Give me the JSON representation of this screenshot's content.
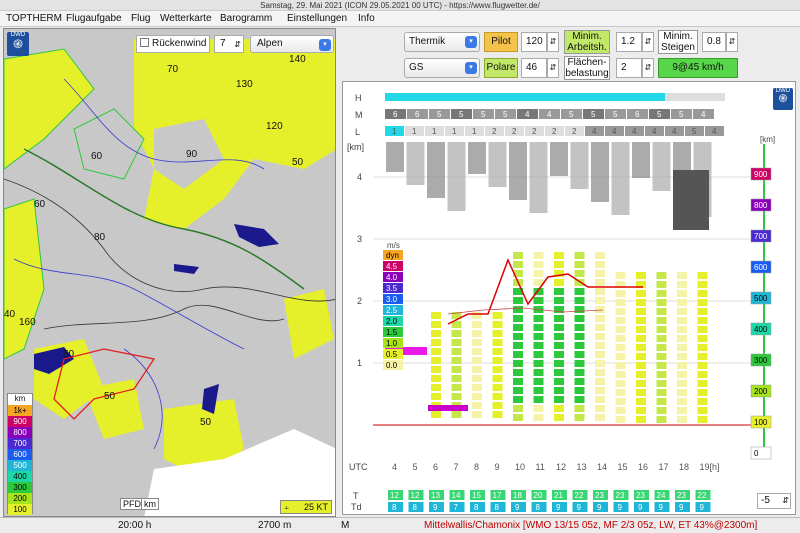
{
  "window": {
    "title": "Samstag, 29. Mai 2021 (ICON 29.05.2021 00 UTC) - https://www.flugwetter.de/"
  },
  "menu": [
    "TOPTHERM",
    "Flugaufgabe",
    "Flug",
    "Wetterkarte",
    "Barogramm",
    "Einstellungen",
    "Info"
  ],
  "map": {
    "dwd_logo": "DWD",
    "tailwind_checkbox_label": "Rückenwind",
    "tailwind_value": "7",
    "region_select": "Alpen",
    "contour_labels": [
      "70",
      "140",
      "130",
      "120",
      "60",
      "90",
      "50",
      "60",
      "80",
      "40",
      "160",
      "50",
      "50",
      "50"
    ],
    "legend": {
      "unit": "km",
      "items": [
        {
          "label": "1k+",
          "color": "#f5a623"
        },
        {
          "label": "900",
          "color": "#cc0066"
        },
        {
          "label": "800",
          "color": "#8a00b8"
        },
        {
          "label": "700",
          "color": "#4b2bd1"
        },
        {
          "label": "600",
          "color": "#1a5cf0"
        },
        {
          "label": "500",
          "color": "#1fb6d8"
        },
        {
          "label": "400",
          "color": "#1cd7a8"
        },
        {
          "label": "300",
          "color": "#2ec83c"
        },
        {
          "label": "200",
          "color": "#a6e31b"
        },
        {
          "label": "100",
          "color": "#e6f02a"
        }
      ]
    },
    "pfd_label": "PFD",
    "km_label": "km",
    "wind_badge": "25 KT"
  },
  "controls": {
    "mode_select": "Thermik",
    "pilot_label": "Pilot",
    "pilot_value": "120",
    "min_work_label_1": "Minim.",
    "min_work_label_2": "Arbeitsh.",
    "min_work_value": "1.2",
    "min_climb_label_1": "Minim.",
    "min_climb_label_2": "Steigen",
    "min_climb_value": "0.8",
    "glider_select": "GS",
    "polar_label": "Polare",
    "polar_value": "46",
    "wing_load_label_1": "Flächen-",
    "wing_load_label_2": "belastung",
    "wing_load_value": "2",
    "result": "9@45 km/h"
  },
  "chart_data": {
    "type": "heatmap",
    "cloud_rows": [
      "H",
      "M",
      "L"
    ],
    "y_unit": "[km]",
    "y_ticks": [
      "1",
      "2",
      "3",
      "4"
    ],
    "x_label": "UTC",
    "x_ticks": [
      "4",
      "5",
      "6",
      "7",
      "8",
      "9",
      "10",
      "11",
      "12",
      "13",
      "14",
      "15",
      "16",
      "17",
      "18",
      "19[h]"
    ],
    "m_row_values": [
      "6",
      "6",
      "5",
      "5",
      "5",
      "5",
      "4",
      "4",
      "5",
      "5",
      "5",
      "6",
      "5",
      "5",
      "4"
    ],
    "l_row_values": [
      "1",
      "1",
      "1",
      "1",
      "1",
      "2",
      "2",
      "2",
      "2",
      "2",
      "4",
      "4",
      "4",
      "4",
      "4",
      "5",
      "4"
    ],
    "climb_legend_unit": "m/s",
    "climb_legend": [
      {
        "label": "dyn",
        "color": "#f5a623"
      },
      {
        "label": "4.5",
        "color": "#cc0066"
      },
      {
        "label": "4.0",
        "color": "#8a00b8"
      },
      {
        "label": "3.5",
        "color": "#4b2bd1"
      },
      {
        "label": "3.0",
        "color": "#1a5cf0"
      },
      {
        "label": "2.5",
        "color": "#1fb6d8"
      },
      {
        "label": "2.0",
        "color": "#1cd7a8"
      },
      {
        "label": "1.5",
        "color": "#2ec83c"
      },
      {
        "label": "1.0",
        "color": "#a6e31b"
      },
      {
        "label": "0.5",
        "color": "#e6f02a"
      },
      {
        "label": "0.0",
        "color": "#f6f3a8"
      }
    ],
    "right_scale_unit": "[km]",
    "right_scale": [
      {
        "label": "900",
        "color": "#cc0066"
      },
      {
        "label": "800",
        "color": "#8a00b8"
      },
      {
        "label": "700",
        "color": "#4b2bd1"
      },
      {
        "label": "600",
        "color": "#1a5cf0"
      },
      {
        "label": "500",
        "color": "#1fb6d8"
      },
      {
        "label": "400",
        "color": "#1cd7a8"
      },
      {
        "label": "300",
        "color": "#2ec83c"
      },
      {
        "label": "200",
        "color": "#a6e31b"
      },
      {
        "label": "100",
        "color": "#e6f02a"
      },
      {
        "label": "0",
        "color": "#ffffff"
      }
    ],
    "temp_row_label": "T",
    "dew_row_label": "Td",
    "temps": [
      "12",
      "12",
      "13",
      "14",
      "15",
      "17",
      "18",
      "20",
      "21",
      "22",
      "23",
      "23",
      "23",
      "24",
      "23",
      "22"
    ],
    "dewpoints": [
      "8",
      "8",
      "9",
      "7",
      "8",
      "8",
      "9",
      "8",
      "9",
      "9",
      "9",
      "9",
      "9",
      "9",
      "9",
      "9"
    ],
    "offset_value": "-5"
  },
  "status": {
    "time": "20:00 h",
    "altitude": "2700 m",
    "mode": "M",
    "info": "Mittelwallis/Chamonix [WMO 13/15 05z, MF 2/3 05z, LW, ET  43%@2300m]"
  }
}
